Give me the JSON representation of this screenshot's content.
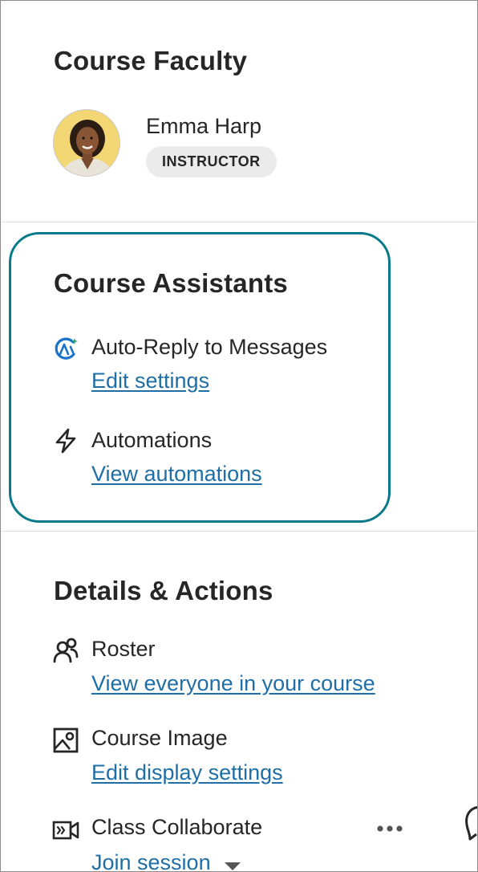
{
  "faculty": {
    "title": "Course Faculty",
    "name": "Emma Harp",
    "role": "INSTRUCTOR"
  },
  "assistants": {
    "title": "Course Assistants",
    "items": [
      {
        "icon": "ai-assistant-icon",
        "label": "Auto-Reply to Messages",
        "link": "Edit settings"
      },
      {
        "icon": "lightning-icon",
        "label": "Automations",
        "link": "View automations"
      }
    ]
  },
  "details": {
    "title": "Details & Actions",
    "items": [
      {
        "icon": "roster-icon",
        "label": "Roster",
        "link": "View everyone in your course"
      },
      {
        "icon": "image-icon",
        "label": "Course Image",
        "link": "Edit display settings"
      },
      {
        "icon": "video-icon",
        "label": "Class Collaborate",
        "link": "Join session"
      }
    ]
  },
  "colors": {
    "accent": "#0a7a8a",
    "link": "#1f6ea5",
    "text": "#262626",
    "badge_bg": "#ebebeb"
  }
}
